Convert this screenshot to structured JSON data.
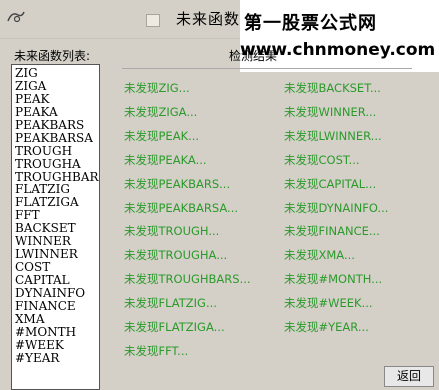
{
  "window": {
    "title": "未来函数检",
    "icon": "app-icon"
  },
  "watermark": {
    "line1": "第一股票公式网",
    "line2": "www.chnmoney.com"
  },
  "list": {
    "label": "未来函数列表:",
    "items": [
      "ZIG",
      "ZIGA",
      "PEAK",
      "PEAKA",
      "PEAKBARS",
      "PEAKBARSA",
      "TROUGH",
      "TROUGHA",
      "TROUGHBARS",
      "FLATZIG",
      "FLATZIGA",
      "FFT",
      "BACKSET",
      "WINNER",
      "LWINNER",
      "COST",
      "CAPITAL",
      "DYNAINFO",
      "FINANCE",
      "XMA",
      "#MONTH",
      "#WEEK",
      "#YEAR"
    ]
  },
  "results": {
    "label": "检测结果",
    "left": [
      "未发现ZIG...",
      "未发现ZIGA...",
      "未发现PEAK...",
      "未发现PEAKA...",
      "未发现PEAKBARS...",
      "未发现PEAKBARSA...",
      "未发现TROUGH...",
      "未发现TROUGHA...",
      "未发现TROUGHBARS...",
      "未发现FLATZIG...",
      "未发现FLATZIGA...",
      "未发现FFT..."
    ],
    "right": [
      "未发现BACKSET...",
      "未发现WINNER...",
      "未发现LWINNER...",
      "未发现COST...",
      "未发现CAPITAL...",
      "未发现DYNAINFO...",
      "未发现FINANCE...",
      "未发现XMA...",
      "未发现#MONTH...",
      "未发现#WEEK...",
      "未发现#YEAR..."
    ],
    "text_color": "#2a9a2a"
  },
  "buttons": {
    "back": "返回"
  }
}
